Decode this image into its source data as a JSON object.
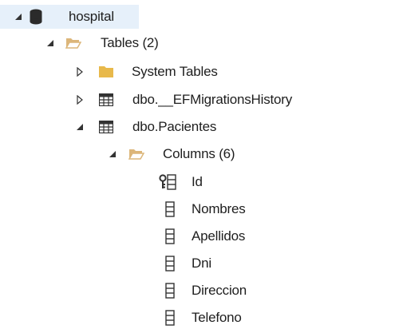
{
  "tree": {
    "database": {
      "label": "hospital",
      "expanded": true,
      "icon": "database-icon"
    },
    "tables_folder": {
      "label": "Tables (2)",
      "expanded": true,
      "icon": "open-folder-icon"
    },
    "system_tables": {
      "label": "System Tables",
      "expanded": false,
      "icon": "closed-folder-icon"
    },
    "migrations_table": {
      "label": "dbo.__EFMigrationsHistory",
      "expanded": false,
      "icon": "table-icon"
    },
    "pacientes_table": {
      "label": "dbo.Pacientes",
      "expanded": true,
      "icon": "table-icon"
    },
    "columns_folder": {
      "label": "Columns (6)",
      "expanded": true,
      "icon": "open-folder-icon"
    },
    "columns": [
      {
        "label": "Id",
        "icon": "primary-key-column-icon"
      },
      {
        "label": "Nombres",
        "icon": "column-icon"
      },
      {
        "label": "Apellidos",
        "icon": "column-icon"
      },
      {
        "label": "Dni",
        "icon": "column-icon"
      },
      {
        "label": "Direccion",
        "icon": "column-icon"
      },
      {
        "label": "Telefono",
        "icon": "column-icon"
      }
    ]
  },
  "colors": {
    "selection": "#e6f0fa",
    "folder": "#dcb67a",
    "folder_closed": "#e8b94b",
    "database": "#2b2b2b",
    "table_grid": "#333333",
    "expander": "#333333"
  }
}
